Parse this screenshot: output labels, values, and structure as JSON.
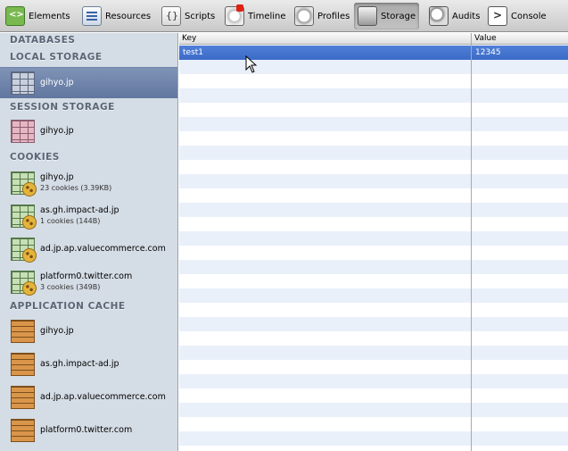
{
  "toolbar": {
    "buttons": [
      {
        "label": "Elements",
        "icon": "elements-icon"
      },
      {
        "label": "Resources",
        "icon": "resources-icon"
      },
      {
        "label": "Scripts",
        "icon": "scripts-icon"
      },
      {
        "label": "Timeline",
        "icon": "timeline-icon"
      },
      {
        "label": "Profiles",
        "icon": "profiles-icon"
      },
      {
        "label": "Storage",
        "icon": "storage-icon",
        "active": true
      },
      {
        "label": "Audits",
        "icon": "audits-icon"
      },
      {
        "label": "Console",
        "icon": "console-icon"
      }
    ]
  },
  "sidebar": {
    "sections": {
      "databases": "DATABASES",
      "local_storage": "LOCAL STORAGE",
      "session_storage": "SESSION STORAGE",
      "cookies": "COOKIES",
      "application_cache": "APPLICATION CACHE"
    },
    "local_storage_items": [
      {
        "title": "gihyo.jp",
        "selected": true
      }
    ],
    "session_storage_items": [
      {
        "title": "gihyo.jp"
      }
    ],
    "cookie_items": [
      {
        "title": "gihyo.jp",
        "sub": "23 cookies (3.39KB)"
      },
      {
        "title": "as.gh.impact-ad.jp",
        "sub": "1 cookies (144B)"
      },
      {
        "title": "ad.jp.ap.valuecommerce.com",
        "sub": ""
      },
      {
        "title": "platform0.twitter.com",
        "sub": "3 cookies (349B)"
      }
    ],
    "appcache_items": [
      {
        "title": "gihyo.jp"
      },
      {
        "title": "as.gh.impact-ad.jp"
      },
      {
        "title": "ad.jp.ap.valuecommerce.com"
      },
      {
        "title": "platform0.twitter.com"
      }
    ]
  },
  "grid": {
    "columns": [
      "Key",
      "Value"
    ],
    "rows": [
      {
        "key": "test1",
        "value": "12345",
        "selected": true
      }
    ]
  },
  "colors": {
    "selection": "#3c6bc8",
    "sidebar_bg": "#d4dce5",
    "zebra": "#eaf0fa"
  }
}
